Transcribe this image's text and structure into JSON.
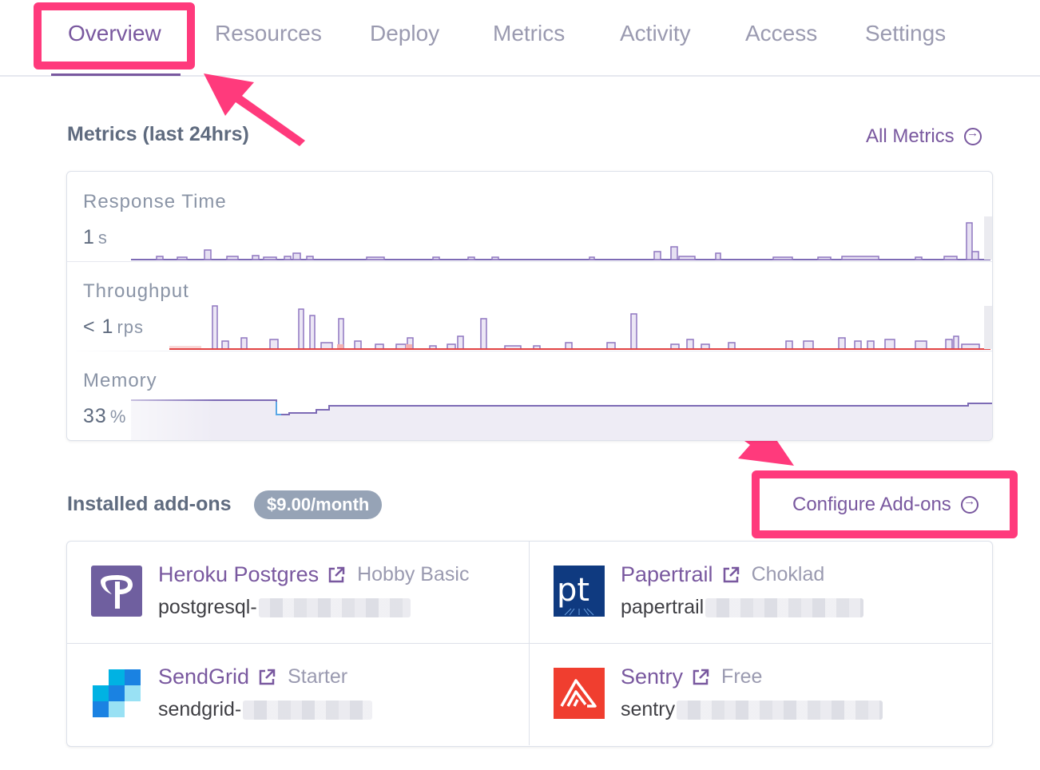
{
  "tabs": [
    {
      "label": "Overview",
      "active": true
    },
    {
      "label": "Resources"
    },
    {
      "label": "Deploy"
    },
    {
      "label": "Metrics"
    },
    {
      "label": "Activity"
    },
    {
      "label": "Access"
    },
    {
      "label": "Settings"
    }
  ],
  "metrics_section": {
    "title": "Metrics (last 24hrs)",
    "all_metrics_label": "All Metrics",
    "rows": [
      {
        "label": "Response Time",
        "value": "1",
        "unit": "s"
      },
      {
        "label": "Throughput",
        "value": "< 1",
        "unit": "rps"
      },
      {
        "label": "Memory",
        "value": "33",
        "unit": "%"
      }
    ]
  },
  "addons_section": {
    "title": "Installed add-ons",
    "price": "$9.00/month",
    "configure_label": "Configure Add-ons",
    "items": [
      {
        "name": "Heroku Postgres",
        "plan": "Hobby Basic",
        "resource": "postgresql-",
        "logo": "heroku-postgres-logo",
        "color": "#6f5f9f"
      },
      {
        "name": "Papertrail",
        "plan": "Choklad",
        "resource": "papertrail",
        "logo": "papertrail-logo",
        "color": "#0f3a80"
      },
      {
        "name": "SendGrid",
        "plan": "Starter",
        "resource": "sendgrid-",
        "logo": "sendgrid-logo",
        "color": "#1a82e2"
      },
      {
        "name": "Sentry",
        "plan": "Free",
        "resource": "sentry",
        "logo": "sentry-logo",
        "color": "#f03e2f"
      }
    ]
  },
  "colors": {
    "accent": "#79589f",
    "highlight": "#ff3a7c",
    "throughput_line": "#e24343",
    "chart_bar": "#8f77c0"
  }
}
